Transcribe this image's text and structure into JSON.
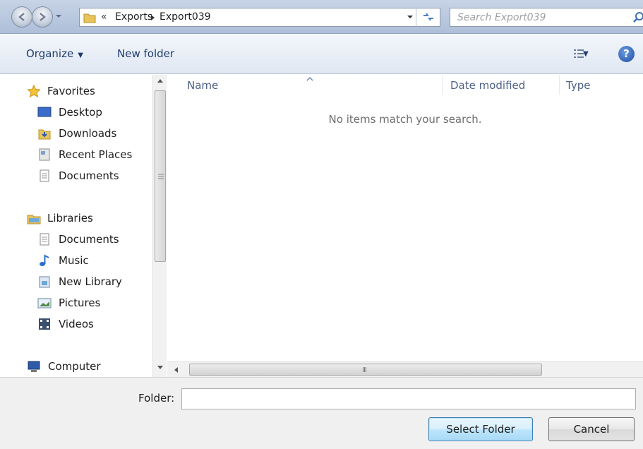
{
  "address_bar": {
    "overflow_chevron": "«",
    "breadcrumb": [
      "Exports",
      "Export039"
    ]
  },
  "search": {
    "placeholder": "Search Export039"
  },
  "toolbar": {
    "organize": "Organize",
    "new_folder": "New folder"
  },
  "nav": {
    "favorites": {
      "label": "Favorites",
      "items": [
        "Desktop",
        "Downloads",
        "Recent Places",
        "Documents"
      ]
    },
    "libraries": {
      "label": "Libraries",
      "items": [
        "Documents",
        "Music",
        "New Library",
        "Pictures",
        "Videos"
      ]
    },
    "computer": {
      "label": "Computer"
    }
  },
  "file_list": {
    "columns": [
      "Name",
      "Date modified",
      "Type"
    ],
    "empty_message": "No items match your search."
  },
  "footer": {
    "folder_label": "Folder:",
    "folder_value": "",
    "select_button": "Select Folder",
    "cancel_button": "Cancel"
  },
  "scrollbar": {
    "grip": "III"
  },
  "colors": {
    "accent": "#1e3c6e",
    "column_header": "#4d6185",
    "toolbar_bg": "#dfe7f2",
    "address_bg": "#aebfd8"
  },
  "icons": {
    "back": "back-arrow-icon",
    "forward": "forward-arrow-icon",
    "refresh": "refresh-icon",
    "search": "search-icon",
    "views": "views-icon",
    "help": "help-icon"
  }
}
